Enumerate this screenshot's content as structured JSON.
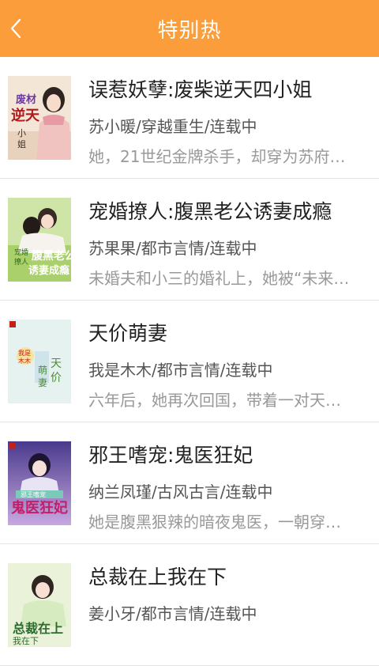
{
  "header": {
    "title": "特别热",
    "back_icon": "chevron-left-icon"
  },
  "books": [
    {
      "title": "误惹妖孽:废柴逆天四小姐",
      "meta": "苏小暖/穿越重生/连载中",
      "desc": "她，21世纪金牌杀手，却穿为苏府…",
      "cover_text": "废材逆天小姐"
    },
    {
      "title": "宠婚撩人:腹黑老公诱妻成瘾",
      "meta": "苏果果/都市言情/连载中",
      "desc": "未婚夫和小三的婚礼上，她被“未来…",
      "cover_text": "宠婚撩人腹黑老公诱妻成瘾"
    },
    {
      "title": "天价萌妻",
      "meta": "我是木木/都市言情/连载中",
      "desc": "六年后，她再次回国，带着一对天…",
      "cover_text": "天价萌妻"
    },
    {
      "title": "邪王嗜宠:鬼医狂妃",
      "meta": "纳兰凤瑾/古风古言/连载中",
      "desc": "她是腹黑狠辣的暗夜鬼医，一朝穿…",
      "cover_text": "邪王嗜宠鬼医狂妃"
    },
    {
      "title": "总裁在上我在下",
      "meta": "姜小牙/都市言情/连载中",
      "desc": "",
      "cover_text": "总裁在上我在下"
    }
  ]
}
